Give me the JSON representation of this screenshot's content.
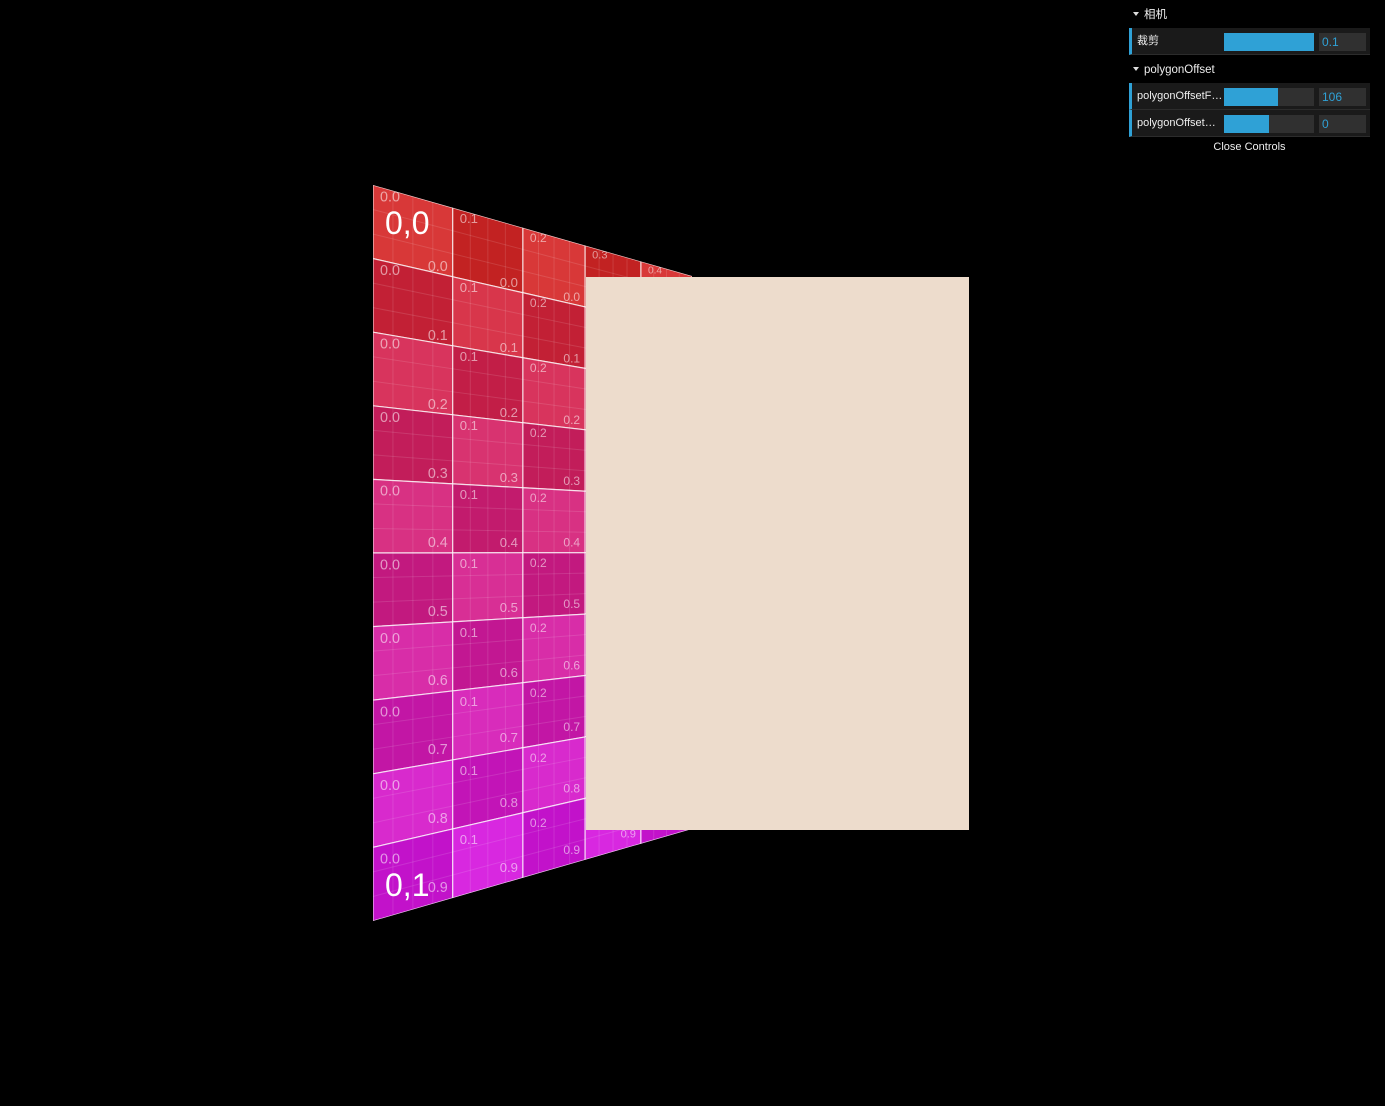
{
  "gui": {
    "folders": [
      {
        "title": "相机",
        "controls": [
          {
            "label": "裁剪",
            "value": "0.1",
            "fill": 1.0
          }
        ]
      },
      {
        "title": "polygonOffset",
        "controls": [
          {
            "label": "polygonOffsetF…",
            "value": "106",
            "fill": 0.6
          },
          {
            "label": "polygonOffsetU…",
            "value": "0",
            "fill": 0.5
          }
        ]
      }
    ],
    "close_label": "Close Controls"
  },
  "scene": {
    "background": "#000000",
    "front_plane_color": "#eddccc",
    "texture": {
      "corner_top": "0,0",
      "corner_bottom": "0,1",
      "col_labels": [
        "0.0",
        "0.1",
        "0.2",
        "0.3",
        "0.4"
      ],
      "row_labels": [
        "0.0",
        "0.1",
        "0.2",
        "0.3",
        "0.4",
        "0.5",
        "0.6",
        "0.7",
        "0.8",
        "0.9"
      ],
      "color_top": "#d03030",
      "color_bottom": "#d020d8"
    }
  }
}
